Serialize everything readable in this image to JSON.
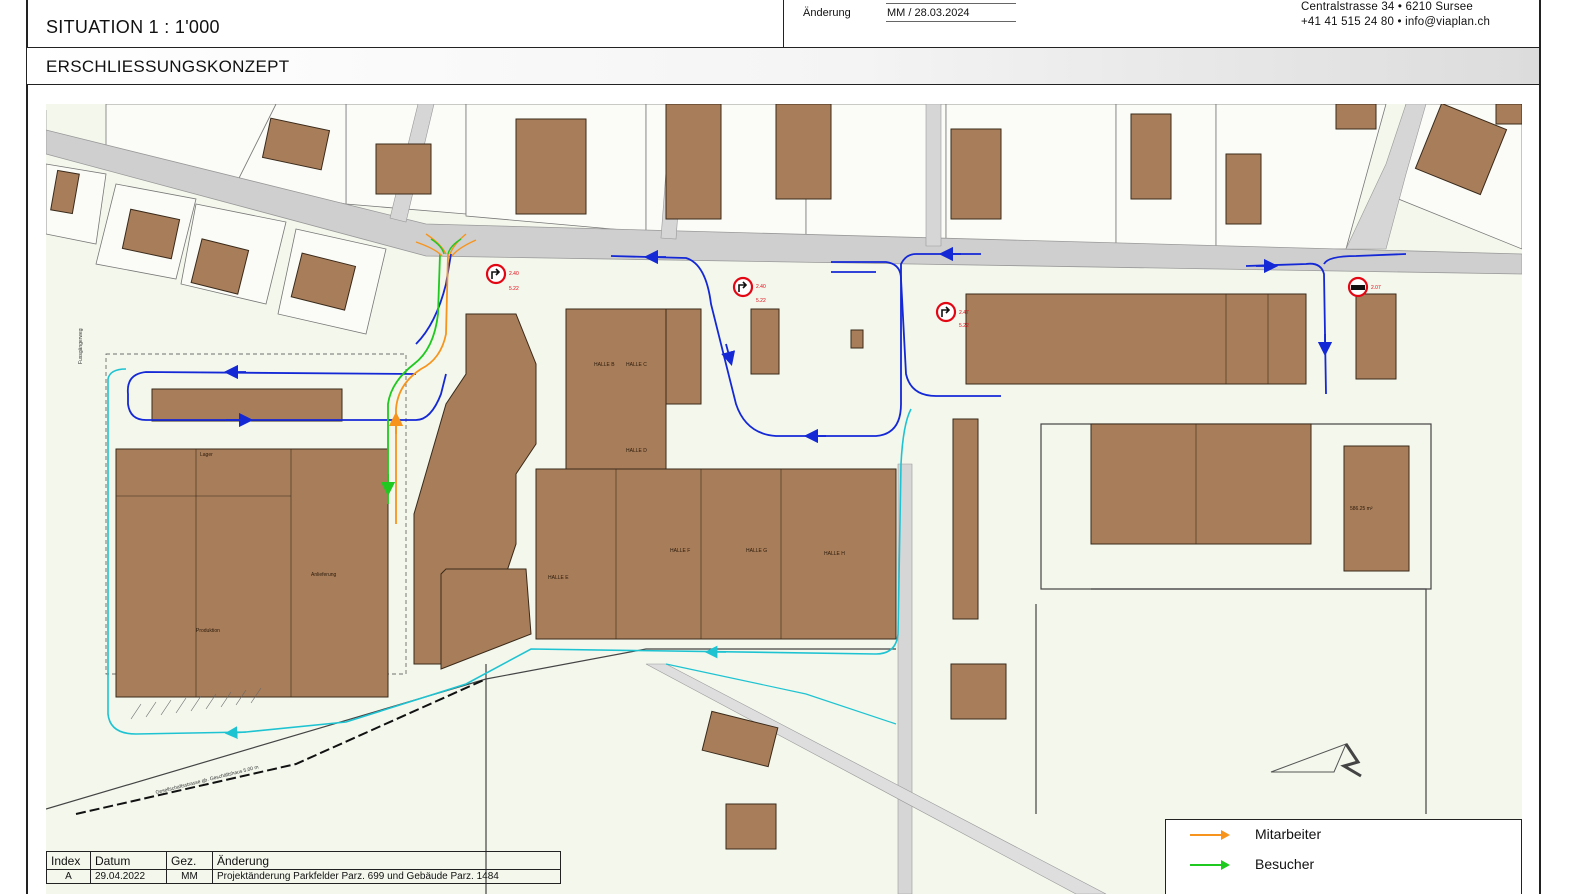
{
  "header": {
    "scale_title": "SITUATION   1 : 1'000",
    "change_label": "Änderung",
    "change_value": "MM / 28.03.2024",
    "firm_address": "Centralstrasse 34 • 6210 Sursee",
    "firm_contact": "+41 41 515 24 80 • info@viaplan.ch"
  },
  "subtitle": "ERSCHLIESSUNGSKONZEPT",
  "revision_table": {
    "columns": [
      "Index",
      "Datum",
      "Gez.",
      "Änderung"
    ],
    "rows": [
      {
        "index": "A",
        "date": "29.04.2022",
        "drawn": "MM",
        "change": "Projektänderung Parkfelder Parz. 699 und Gebäude Parz. 1484"
      }
    ]
  },
  "legend": {
    "items": [
      {
        "label": "Mitarbeiter",
        "color": "#f7941d"
      },
      {
        "label": "Besucher",
        "color": "#1fc91f"
      }
    ]
  },
  "map": {
    "colors": {
      "background": "#f3f7ec",
      "building": "#a87d5a",
      "building_outline": "#3a2a1a",
      "parcel": "#555555",
      "street": "#cfcfcf",
      "route_blue": "#1428d6",
      "route_cyan": "#1ec3d2",
      "route_orange": "#f7941d",
      "route_green": "#1fc91f",
      "sign_red": "#e30613"
    },
    "building_labels": [
      "Lager",
      "Produktion",
      "Anlieferung",
      "HALLE B",
      "HALLE C",
      "HALLE D",
      "HALLE E",
      "HALLE F",
      "HALLE G",
      "HALLE H"
    ],
    "area_label": "586.25 m²",
    "street_labels": [
      "Fussgängerweg",
      "Gesellschaftsstrasse gb. Geschäftshaus 5.00 m"
    ],
    "signs": [
      {
        "code_a": "2.40",
        "code_b": "5.22"
      },
      {
        "code_a": "2.40",
        "code_b": "5.22"
      },
      {
        "code_a": "2.47",
        "code_b": "5.22"
      },
      {
        "code_a": "2.07",
        "code_b": ""
      }
    ]
  }
}
